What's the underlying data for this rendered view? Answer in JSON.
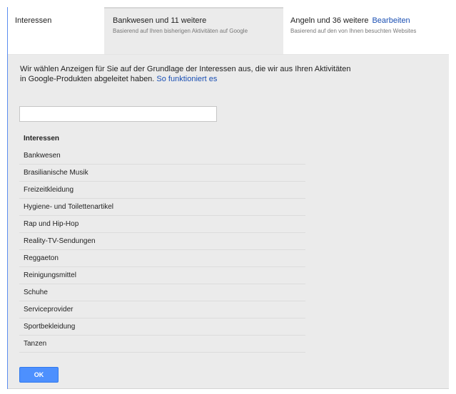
{
  "tabs": [
    {
      "title": "Interessen",
      "subtitle": ""
    },
    {
      "title": "Bankwesen und 11 weitere",
      "subtitle": "Basierend auf Ihren bisherigen Aktivitäten auf Google"
    },
    {
      "title": "Angeln und 36 weitere",
      "subtitle": "Basierend auf den von Ihnen besuchten Websites",
      "link": "Bearbeiten"
    }
  ],
  "intro": {
    "text": "Wir wählen Anzeigen für Sie auf der Grundlage der Interessen aus, die wir aus Ihren Aktivitäten in Google-Produkten abgeleitet haben.",
    "link": "So funktioniert es"
  },
  "filter": {
    "value": "",
    "placeholder": ""
  },
  "list": {
    "header": "Interessen",
    "items": [
      "Bankwesen",
      "Brasilianische Musik",
      "Freizeitkleidung",
      "Hygiene- und Toilettenartikel",
      "Rap und Hip-Hop",
      "Reality-TV-Sendungen",
      "Reggaeton",
      "Reinigungsmittel",
      "Schuhe",
      "Serviceprovider",
      "Sportbekleidung",
      "Tanzen"
    ]
  },
  "ok_button": {
    "label": "OK"
  },
  "colors": {
    "accent": "#4d90fe",
    "link": "#1a4fb3",
    "panel_background": "#ebebeb"
  }
}
